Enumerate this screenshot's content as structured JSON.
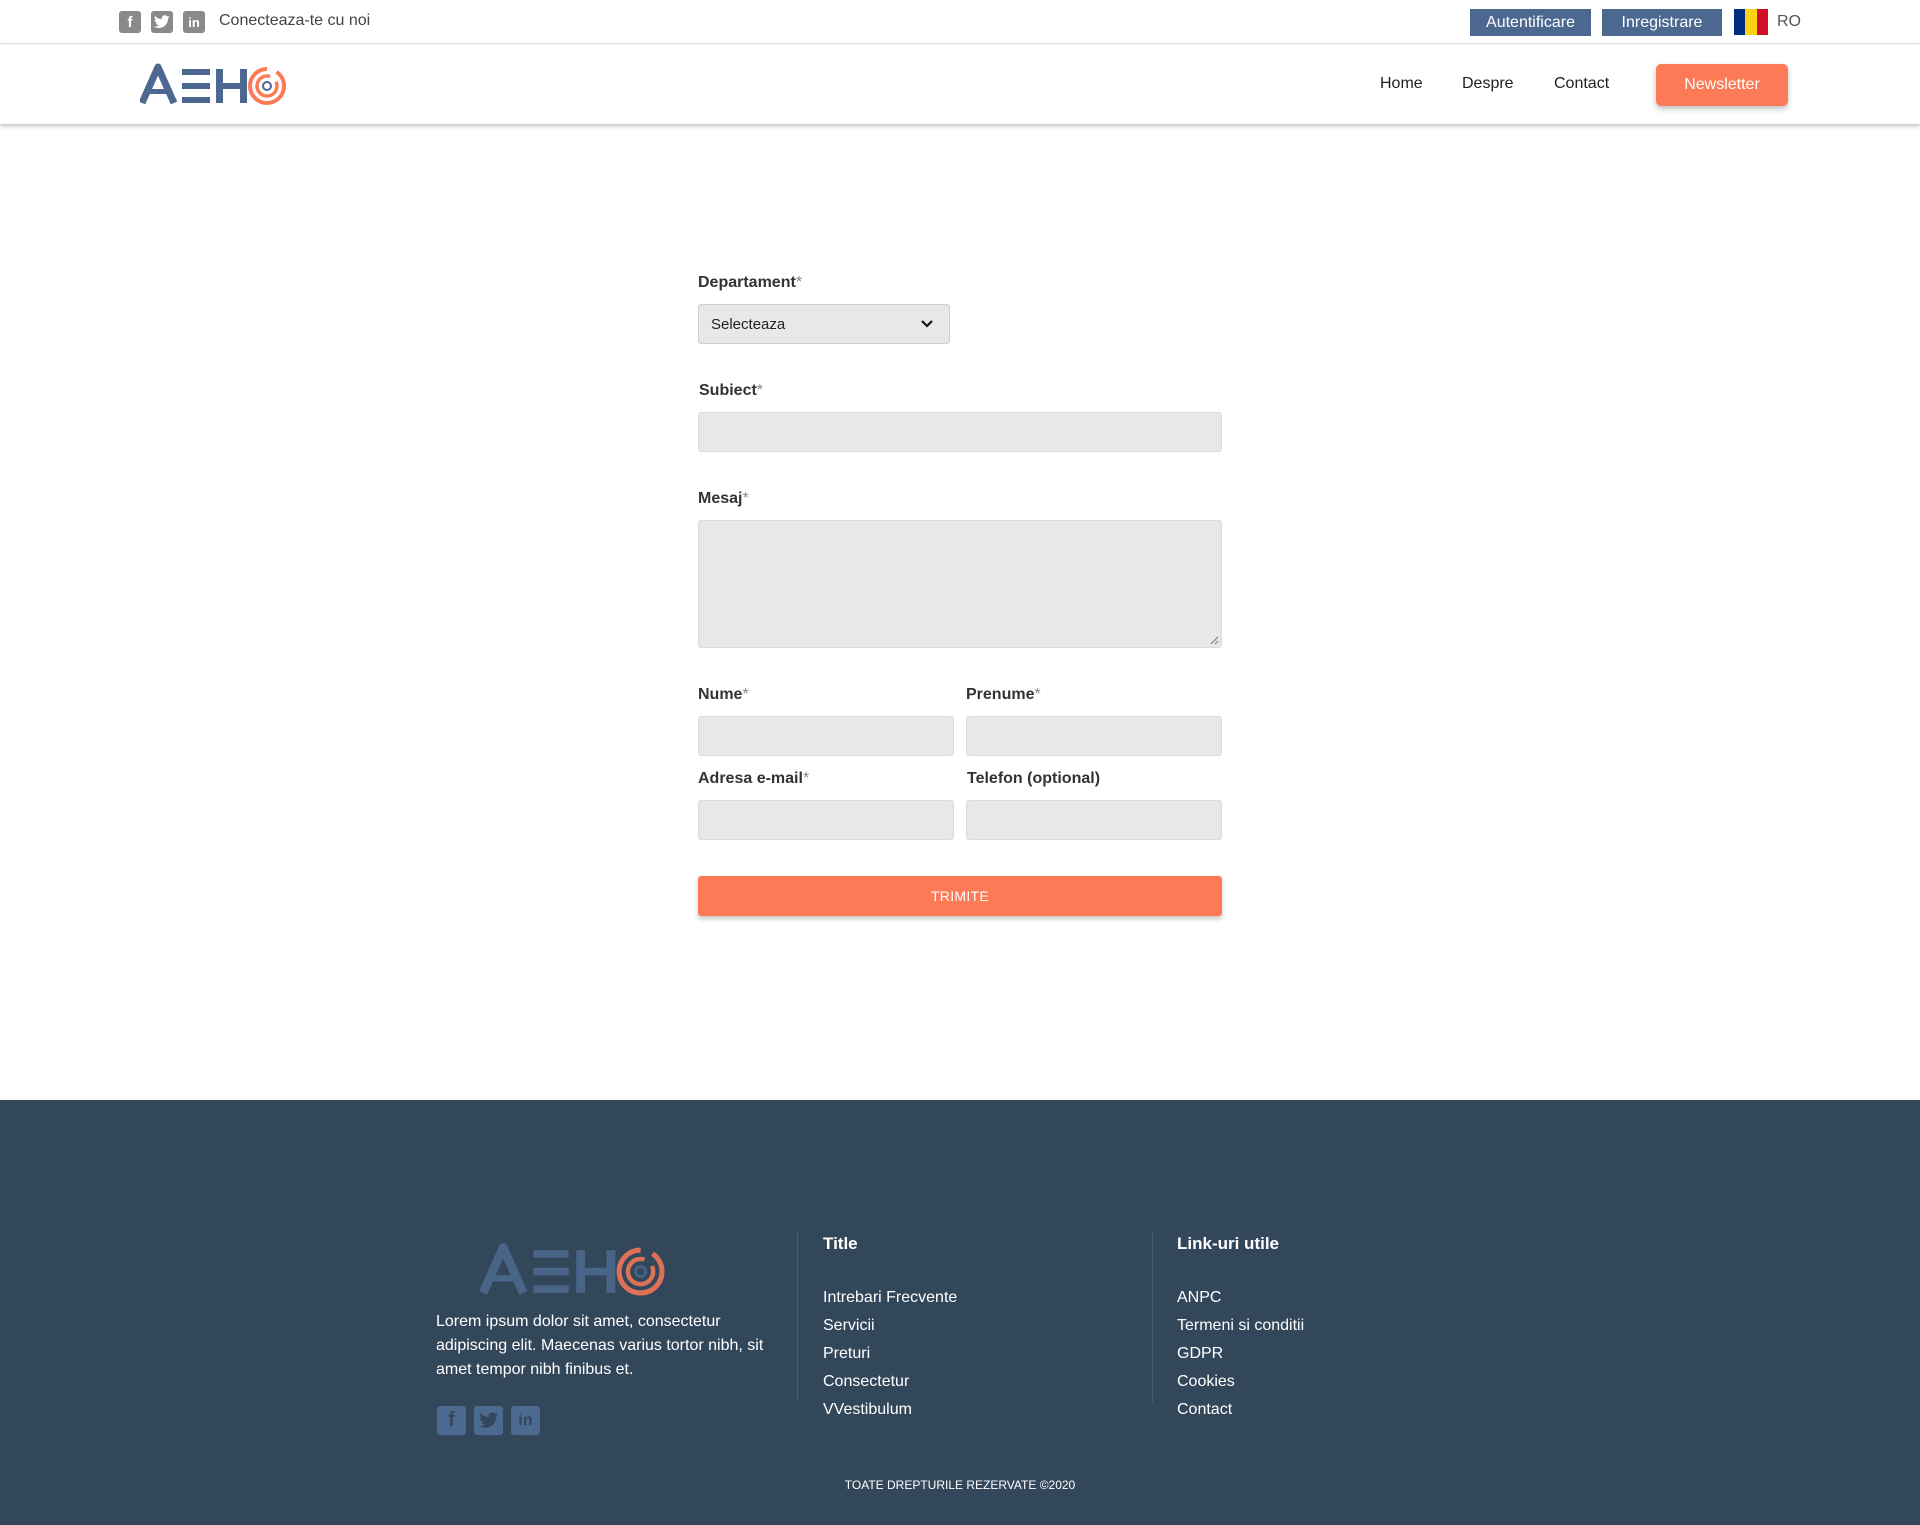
{
  "topbar": {
    "social_icons": [
      "facebook-icon",
      "twitter-icon",
      "linkedin-icon"
    ],
    "connect_text": "Conecteaza-te cu noi",
    "login_label": "Autentificare",
    "register_label": "Inregistrare",
    "language": "RO",
    "flag_colors": [
      "#002b7f",
      "#fcd116",
      "#ce1126"
    ]
  },
  "header": {
    "logo_text": "AEH",
    "nav": [
      "Home",
      "Despre",
      "Contact"
    ],
    "newsletter_label": "Newsletter"
  },
  "form": {
    "department": {
      "label": "Departament",
      "required": "*",
      "selected": "Selecteaza"
    },
    "subject": {
      "label": "Subiect",
      "required": "*",
      "value": ""
    },
    "message": {
      "label": "Mesaj",
      "required": "*",
      "value": ""
    },
    "last_name": {
      "label": "Nume",
      "required": "*",
      "value": ""
    },
    "first_name": {
      "label": "Prenume",
      "required": "*",
      "value": ""
    },
    "email": {
      "label": "Adresa e-mail",
      "required": "*",
      "value": ""
    },
    "phone": {
      "label": "Telefon (optional)",
      "value": ""
    },
    "submit_label": "TRIMITE"
  },
  "footer": {
    "logo_text": "AEH",
    "description": "Lorem ipsum dolor sit amet, consectetur adipiscing elit. Maecenas varius tortor nibh, sit amet tempor nibh finibus et.",
    "social_icons": [
      "facebook-icon",
      "twitter-icon",
      "linkedin-icon"
    ],
    "col1": {
      "title": "Title",
      "links": [
        "Intrebari Frecvente",
        "Servicii",
        "Preturi",
        "Consectetur",
        "VVestibulum"
      ]
    },
    "col2": {
      "title": "Link-uri utile",
      "links": [
        "ANPC",
        "Termeni si conditii",
        "GDPR",
        "Cookies",
        "Contact"
      ]
    },
    "copyright": "TOATE DREPTURILE REZERVATE ©2020"
  },
  "colors": {
    "accent": "#fd7a56",
    "brand_blue": "#4c6890",
    "footer_bg": "#33475b"
  }
}
